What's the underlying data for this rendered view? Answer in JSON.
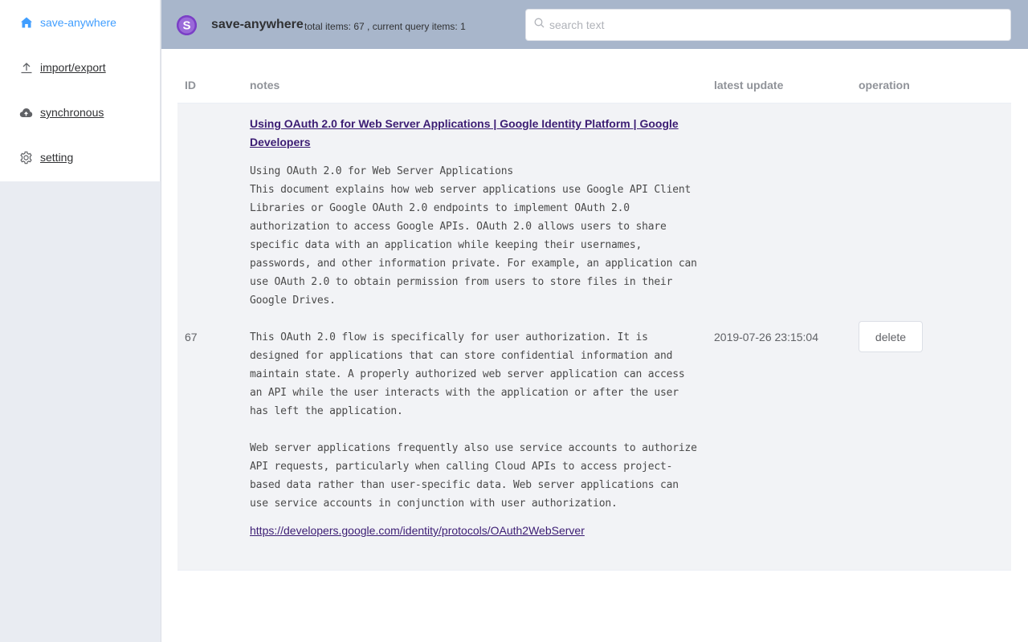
{
  "app": {
    "title": "save-anywhere",
    "stats": "total items: 67 , current query items: 1"
  },
  "sidebar": {
    "items": [
      {
        "label": "save-anywhere",
        "icon": "home-icon",
        "active": true
      },
      {
        "label": "import/export",
        "icon": "upload-icon"
      },
      {
        "label": "synchronous",
        "icon": "cloud-upload-icon"
      },
      {
        "label": "setting",
        "icon": "gear-icon"
      }
    ]
  },
  "search": {
    "placeholder": "search text",
    "value": ""
  },
  "table": {
    "columns": [
      "ID",
      "notes",
      "latest update",
      "operation"
    ],
    "rows": [
      {
        "id": "67",
        "title": "Using OAuth 2.0 for Web Server Applications | Google Identity Platform | Google Developers",
        "body": "Using OAuth 2.0 for Web Server Applications\nThis document explains how web server applications use Google API Client Libraries or Google OAuth 2.0 endpoints to implement OAuth 2.0 authorization to access Google APIs. OAuth 2.0 allows users to share specific data with an application while keeping their usernames, passwords, and other information private. For example, an application can use OAuth 2.0 to obtain permission from users to store files in their Google Drives.\n\nThis OAuth 2.0 flow is specifically for user authorization. It is designed for applications that can store confidential information and maintain state. A properly authorized web server application can access an API while the user interacts with the application or after the user has left the application.\n\nWeb server applications frequently also use service accounts to authorize API requests, particularly when calling Cloud APIs to access project-based data rather than user-specific data. Web server applications can use service accounts in conjunction with user authorization.",
        "url": "https://developers.google.com/identity/protocols/OAuth2WebServer",
        "updated": "2019-07-26 23:15:04",
        "action": "delete"
      }
    ]
  },
  "colors": {
    "header_bg": "#a8b6cb",
    "accent": "#409eff",
    "link": "#3b1c73",
    "logo": "#7a3fc6"
  }
}
